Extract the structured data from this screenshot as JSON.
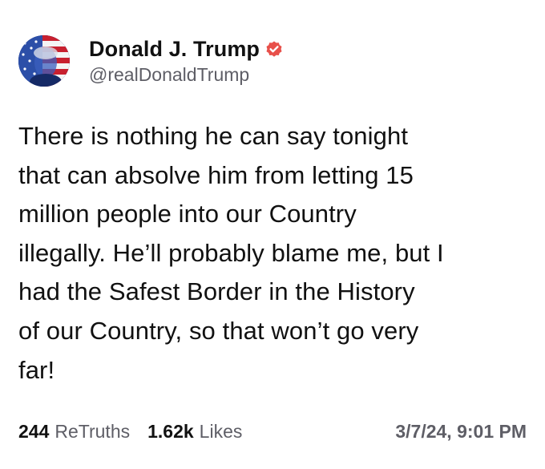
{
  "author": {
    "display_name": "Donald J. Trump",
    "handle": "@realDonaldTrump",
    "avatar_icon": "flag-portrait-avatar",
    "verified_icon": "verified-badge-icon",
    "verified_color": "#e8504a"
  },
  "post": {
    "lines": [
      "There is nothing he can say tonight",
      "that can absolve him from letting 15",
      "million people into our Country",
      "illegally. He’ll probably blame me, but I",
      "had the Safest Border in the History",
      "of our Country, so that won’t go very",
      "far!"
    ]
  },
  "footer": {
    "retruths_count": "244",
    "retruths_label": "ReTruths",
    "likes_count": "1.62k",
    "likes_label": "Likes",
    "timestamp": "3/7/24, 9:01 PM"
  }
}
